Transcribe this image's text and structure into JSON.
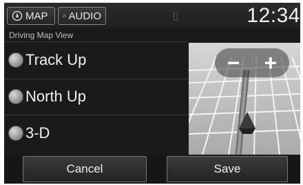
{
  "topbar": {
    "map_label": "MAP",
    "audio_label": "AUDIO",
    "clock": "12:34"
  },
  "subtitle": "Driving Map View",
  "options": [
    {
      "label": "Track Up"
    },
    {
      "label": "North Up"
    },
    {
      "label": "3-D"
    }
  ],
  "map": {
    "zoom_out": "−",
    "zoom_in": "+"
  },
  "buttons": {
    "cancel": "Cancel",
    "save": "Save"
  }
}
